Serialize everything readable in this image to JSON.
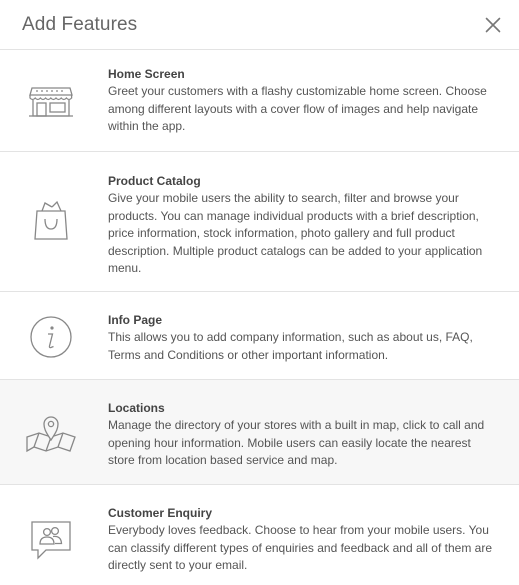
{
  "modal": {
    "title": "Add Features",
    "close_icon": "close-icon"
  },
  "features": [
    {
      "icon": "storefront-icon",
      "name": "Home Screen",
      "description": "Greet your customers with a flashy customizable home screen. Choose among different layouts with a cover flow of images and help navigate within the app."
    },
    {
      "icon": "shopping-bag-icon",
      "name": "Product Catalog",
      "description": "Give your mobile users the ability to search, filter and browse your products. You can manage individual products with a brief description, price information, stock information, photo gallery and full product description. Multiple product catalogs can be added to your application menu."
    },
    {
      "icon": "info-icon",
      "name": "Info Page",
      "description": "This allows you to add company information, such as about us, FAQ, Terms and Conditions or other important information."
    },
    {
      "icon": "map-pin-icon",
      "name": "Locations",
      "description": "Manage the directory of your stores with a built in map, click to call and opening hour information. Mobile users can easily locate the nearest store from location based service and map."
    },
    {
      "icon": "chat-users-icon",
      "name": "Customer Enquiry",
      "description": "Everybody loves feedback. Choose to hear from your mobile users. You can classify different types of enquiries and feedback and all of them are directly sent to your email."
    }
  ]
}
